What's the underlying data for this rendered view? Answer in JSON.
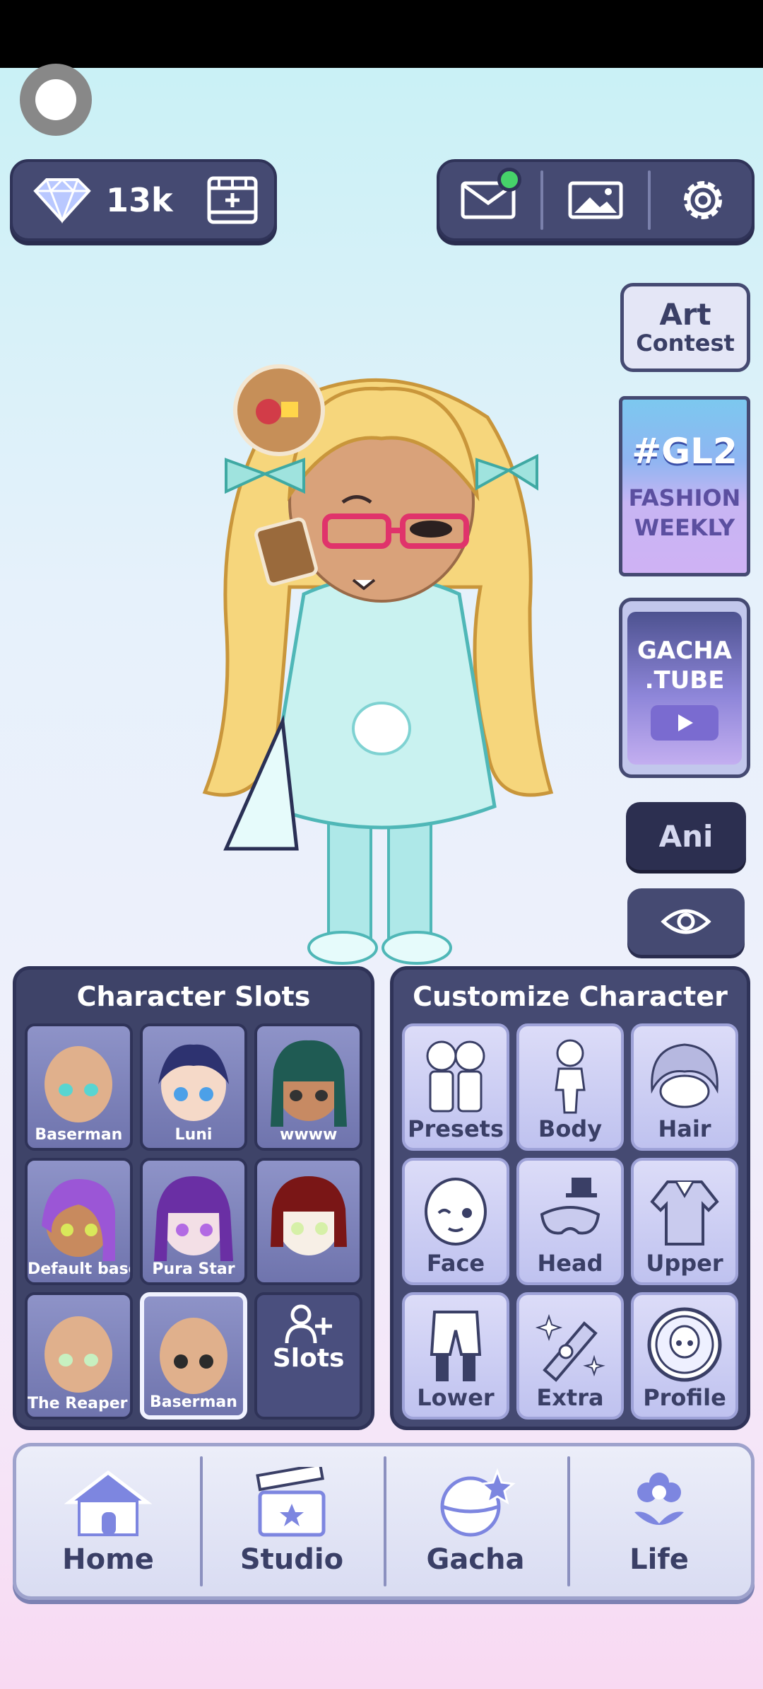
{
  "currency": {
    "amount": "13k"
  },
  "side": {
    "art_contest": {
      "line1": "Art",
      "line2": "Contest"
    },
    "fashion": {
      "tag": "#GL2",
      "line1": "FASHION",
      "line2": "WEEKLY"
    },
    "tube": {
      "line1": "GACHA",
      "line2": ".TUBE"
    },
    "ani_label": "Ani"
  },
  "slots": {
    "title": "Character Slots",
    "items": [
      {
        "name": "Baserman"
      },
      {
        "name": "Luni"
      },
      {
        "name": "wwww"
      },
      {
        "name": "Default base"
      },
      {
        "name": "Pura Star"
      },
      {
        "name": ""
      },
      {
        "name": "The Reaper Bo"
      },
      {
        "name": "Baserman"
      }
    ],
    "add_label": "Slots"
  },
  "customize": {
    "title": "Customize Character",
    "items": [
      {
        "label": "Presets",
        "icon": "presets-icon"
      },
      {
        "label": "Body",
        "icon": "body-icon"
      },
      {
        "label": "Hair",
        "icon": "hair-icon"
      },
      {
        "label": "Face",
        "icon": "face-icon"
      },
      {
        "label": "Head",
        "icon": "head-icon"
      },
      {
        "label": "Upper",
        "icon": "upper-icon"
      },
      {
        "label": "Lower",
        "icon": "lower-icon"
      },
      {
        "label": "Extra",
        "icon": "extra-icon"
      },
      {
        "label": "Profile",
        "icon": "profile-icon"
      }
    ]
  },
  "nav": {
    "items": [
      {
        "label": "Home"
      },
      {
        "label": "Studio"
      },
      {
        "label": "Gacha"
      },
      {
        "label": "Life"
      }
    ]
  },
  "colors": {
    "panel": "#454a72",
    "panel_border": "#2f3358",
    "accent_green": "#46d36a",
    "button_light": "#c8cbf2"
  }
}
